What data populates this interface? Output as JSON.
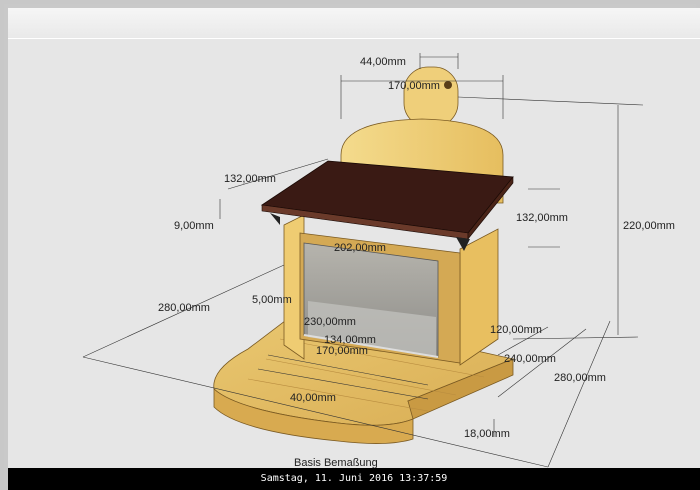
{
  "status": {
    "datetime": "Samstag, 11. Juni 2016 13:37:59"
  },
  "caption": "Basis Bemaßung",
  "dimensions": {
    "hole_width": "44,00mm",
    "back_width": "170,00mm",
    "height": "220,00mm",
    "roof_depth_left": "132,00mm",
    "roof_depth_right": "132,00mm",
    "roof_thickness": "9,00mm",
    "inner_width": "202,00mm",
    "base_depth_left": "280,00mm",
    "glass_offset": "5,00mm",
    "floor_width": "230,00mm",
    "mid_width": "134,00mm",
    "front_width": "170,00mm",
    "side_120": "120,00mm",
    "side_240": "240,00mm",
    "side_280": "280,00mm",
    "front_radius": "40,00mm",
    "base_thickness": "18,00mm"
  },
  "colors": {
    "wood_light": "#f1d27b",
    "wood_mid": "#e5bd5f",
    "wood_dark": "#caa04c",
    "roof": "#3a1a14",
    "glass": "#8b8a86"
  }
}
